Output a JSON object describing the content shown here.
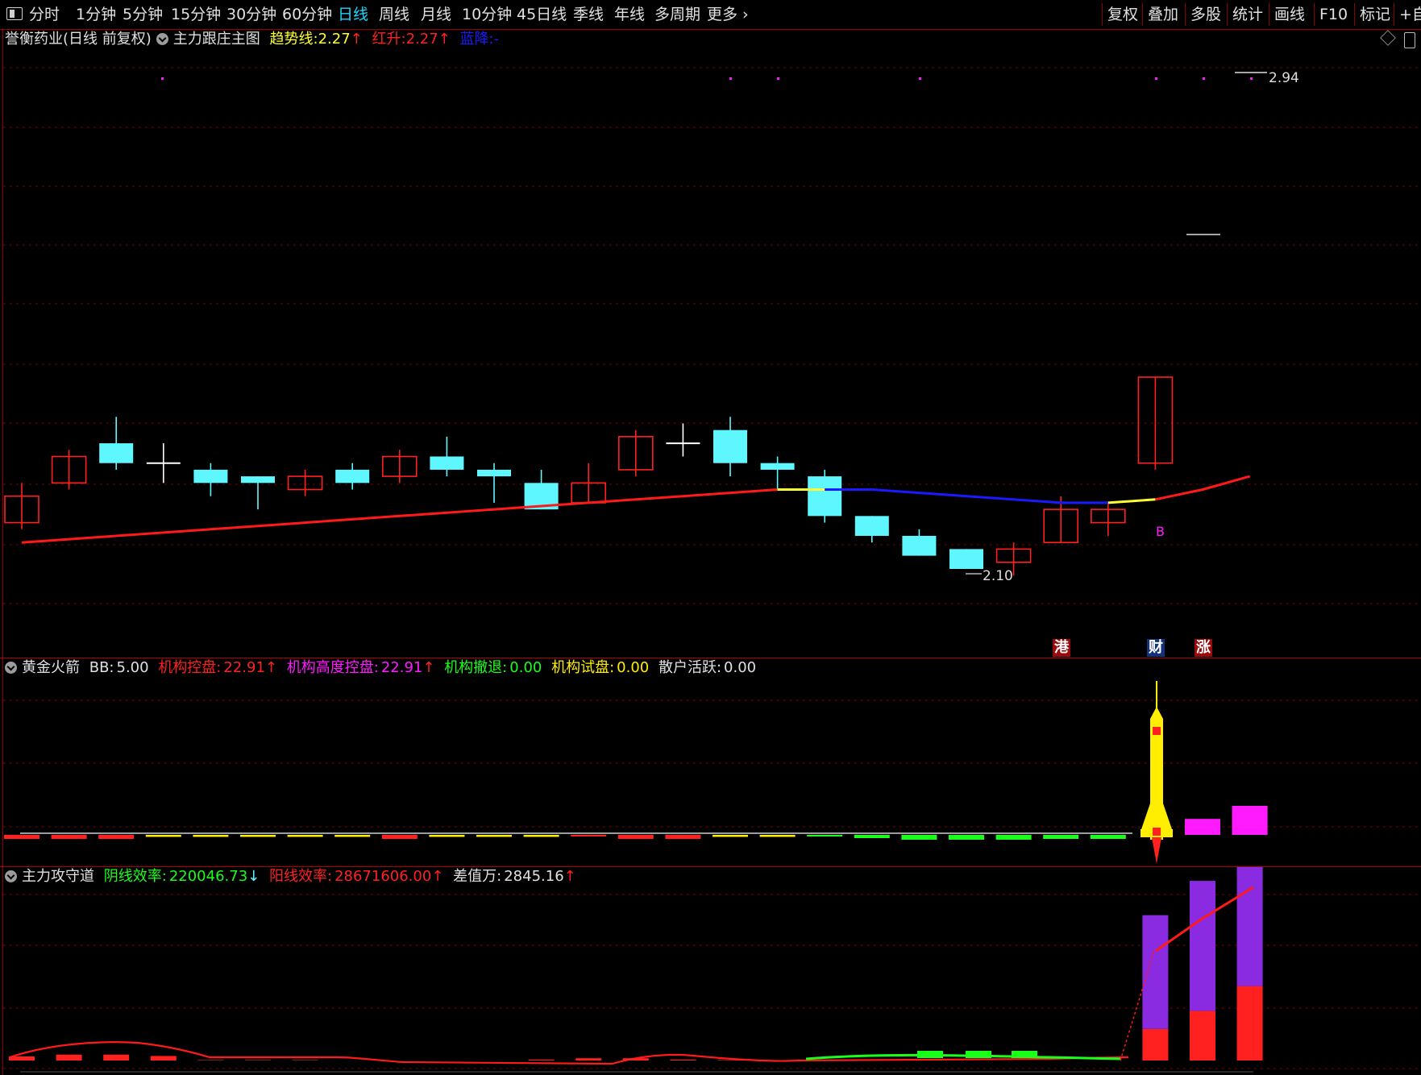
{
  "toolbar": {
    "periods": [
      "分时",
      "1分钟",
      "5分钟",
      "15分钟",
      "30分钟",
      "60分钟",
      "日线",
      "周线",
      "月线",
      "10分钟",
      "45日线",
      "季线",
      "年线",
      "多周期",
      "更多 ›"
    ],
    "active_period": "日线",
    "tools": [
      "复权",
      "叠加",
      "多股",
      "统计",
      "画线",
      "F10",
      "标记",
      "+自"
    ]
  },
  "main_panel": {
    "stock_title": "誉衡药业(日线 前复权)",
    "indicator_name": "主力跟庄主图",
    "trend_label": "趋势线:",
    "trend_value": "2.27",
    "red_label": "红升:",
    "red_value": "2.27",
    "blue_label": "蓝降:",
    "blue_value": "-",
    "high_label": "2.94",
    "low_label": "2.10",
    "signal_b": "B",
    "tags": [
      "港",
      "财",
      "涨"
    ]
  },
  "panel2": {
    "name": "黄金火箭",
    "bb_label": "BB:",
    "bb_value": "5.00",
    "ctrl_label": "机构控盘:",
    "ctrl_value": "22.91",
    "high_ctrl_label": "机构高度控盘:",
    "high_ctrl_value": "22.91",
    "withdraw_label": "机构撤退:",
    "withdraw_value": "0.00",
    "test_label": "机构试盘:",
    "test_value": "0.00",
    "retail_label": "散户活跃:",
    "retail_value": "0.00"
  },
  "panel3": {
    "name": "主力攻守道",
    "yin_label": "阴线效率:",
    "yin_value": "220046.73",
    "yang_label": "阳线效率:",
    "yang_value": "28671606.00",
    "diff_label": "差值万:",
    "diff_value": "2845.16"
  },
  "colors": {
    "up": "#ff2020",
    "down": "#5ff7ff",
    "trend_red": "#ff1a1a",
    "trend_blue": "#1a1aff",
    "trend_yellow": "#ffff33",
    "magenta": "#ff1aff",
    "green": "#1aff1a",
    "yellow": "#ffee00",
    "purple": "#8a2be2"
  },
  "icons": [
    "panel-toggle-icon",
    "indicator-check-icon",
    "diamond-icon",
    "window-toggle-icon",
    "up-arrow-icon",
    "down-arrow-icon"
  ],
  "chart_data": {
    "type": "candlestick",
    "price_range": [
      2.1,
      2.94
    ],
    "candles": [
      {
        "o": 2.17,
        "c": 2.21,
        "h": 2.23,
        "l": 2.16
      },
      {
        "o": 2.23,
        "c": 2.27,
        "h": 2.28,
        "l": 2.22
      },
      {
        "o": 2.29,
        "c": 2.26,
        "h": 2.33,
        "l": 2.25
      },
      {
        "o": 2.26,
        "c": 2.26,
        "h": 2.29,
        "l": 2.23
      },
      {
        "o": 2.25,
        "c": 2.23,
        "h": 2.26,
        "l": 2.21
      },
      {
        "o": 2.24,
        "c": 2.23,
        "h": 2.24,
        "l": 2.19
      },
      {
        "o": 2.22,
        "c": 2.24,
        "h": 2.25,
        "l": 2.21
      },
      {
        "o": 2.25,
        "c": 2.23,
        "h": 2.26,
        "l": 2.22
      },
      {
        "o": 2.24,
        "c": 2.27,
        "h": 2.28,
        "l": 2.23
      },
      {
        "o": 2.27,
        "c": 2.25,
        "h": 2.3,
        "l": 2.24
      },
      {
        "o": 2.25,
        "c": 2.24,
        "h": 2.26,
        "l": 2.2
      },
      {
        "o": 2.23,
        "c": 2.19,
        "h": 2.25,
        "l": 2.19
      },
      {
        "o": 2.2,
        "c": 2.23,
        "h": 2.26,
        "l": 2.2
      },
      {
        "o": 2.25,
        "c": 2.3,
        "h": 2.31,
        "l": 2.24
      },
      {
        "o": 2.29,
        "c": 2.29,
        "h": 2.32,
        "l": 2.27
      },
      {
        "o": 2.31,
        "c": 2.26,
        "h": 2.33,
        "l": 2.24
      },
      {
        "o": 2.26,
        "c": 2.25,
        "h": 2.27,
        "l": 2.22
      },
      {
        "o": 2.24,
        "c": 2.18,
        "h": 2.25,
        "l": 2.17
      },
      {
        "o": 2.18,
        "c": 2.15,
        "h": 2.18,
        "l": 2.14
      },
      {
        "o": 2.15,
        "c": 2.12,
        "h": 2.16,
        "l": 2.12
      },
      {
        "o": 2.13,
        "c": 2.1,
        "h": 2.13,
        "l": 2.1
      },
      {
        "o": 2.11,
        "c": 2.13,
        "h": 2.14,
        "l": 2.09
      },
      {
        "o": 2.14,
        "c": 2.19,
        "h": 2.21,
        "l": 2.14
      },
      {
        "o": 2.17,
        "c": 2.19,
        "h": 2.2,
        "l": 2.15
      },
      {
        "o": 2.26,
        "c": 2.39,
        "h": 2.39,
        "l": 2.25
      }
    ],
    "trend_line": [
      2.14,
      2.145,
      2.15,
      2.155,
      2.16,
      2.165,
      2.17,
      2.175,
      2.18,
      2.185,
      2.19,
      2.195,
      2.2,
      2.205,
      2.21,
      2.215,
      2.22,
      2.22,
      2.22,
      2.215,
      2.21,
      2.205,
      2.2,
      2.2,
      2.205,
      2.22,
      2.24
    ],
    "rocket_bars": [
      -1,
      -1,
      -1,
      -0.5,
      -0.5,
      -0.5,
      -0.5,
      -0.5,
      -1,
      -0.5,
      -0.5,
      -0.5,
      -0.2,
      -1,
      -1,
      -0.5,
      -0.5,
      -0.3,
      -0.8,
      -1.2,
      -1.2,
      -1.2,
      -1,
      -1,
      0,
      1.1,
      2.0
    ],
    "rocket_bar_colors": [
      "r",
      "r",
      "r",
      "y",
      "y",
      "y",
      "y",
      "y",
      "r",
      "y",
      "y",
      "y",
      "r",
      "r",
      "r",
      "y",
      "y",
      "g",
      "g",
      "g",
      "g",
      "g",
      "g",
      "g",
      "y",
      "m",
      "m"
    ],
    "gong_bars": [
      {
        "red": 0.09,
        "purple": 0
      },
      {
        "red": 0.13,
        "purple": 0
      },
      {
        "red": 0.13,
        "purple": 0
      },
      {
        "red": 0.1,
        "purple": 0
      },
      {
        "red": 0.01,
        "purple": 0
      },
      {
        "red": 0.01,
        "purple": 0
      },
      {
        "red": 0.01,
        "purple": 0
      },
      {
        "red": 0.005,
        "purple": 0
      },
      {
        "red": 0,
        "purple": 0
      },
      {
        "red": 0,
        "purple": 0
      },
      {
        "red": 0,
        "purple": 0
      },
      {
        "red": 0.02,
        "purple": 0
      },
      {
        "red": 0.05,
        "purple": 0
      },
      {
        "red": 0.05,
        "purple": 0
      },
      {
        "red": 0.02,
        "purple": 0
      },
      {
        "red": 0.01,
        "purple": 0
      },
      {
        "red": 0,
        "purple": 0
      },
      {
        "red": 0,
        "purple": 0
      },
      {
        "red": 0,
        "purple": 0
      },
      {
        "red": 0,
        "purple": 0
      },
      {
        "red": 0,
        "purple": 0
      },
      {
        "red": 0,
        "purple": 0
      },
      {
        "red": 0,
        "purple": 0
      },
      {
        "red": 0,
        "purple": 0
      },
      {
        "red": 0.14,
        "purple": 0.56
      },
      {
        "red": 0.22,
        "purple": 0.64
      },
      {
        "red": 0.33,
        "purple": 0.73
      }
    ]
  }
}
